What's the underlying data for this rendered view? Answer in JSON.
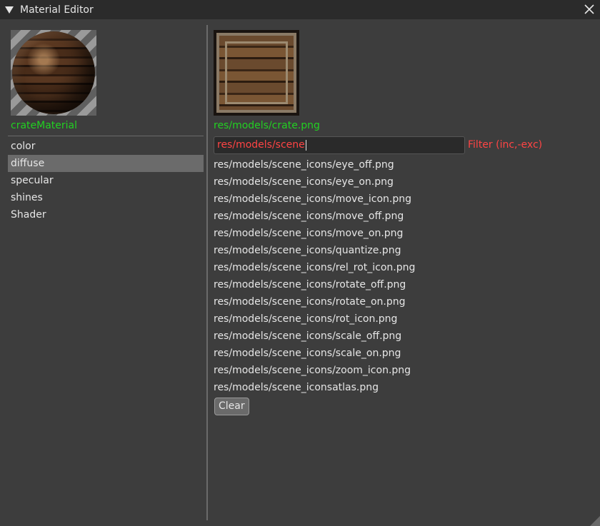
{
  "window": {
    "title": "Material Editor"
  },
  "material": {
    "name": "crateMaterial",
    "properties": [
      "color",
      "diffuse",
      "specular",
      "shines",
      "Shader"
    ],
    "selected_property": "diffuse"
  },
  "texture": {
    "path": "res/models/crate.png",
    "filter_value": "res/models/scene",
    "filter_label": "Filter (inc,-exc)",
    "files": [
      "res/models/scene_icons/eye_off.png",
      "res/models/scene_icons/eye_on.png",
      "res/models/scene_icons/move_icon.png",
      "res/models/scene_icons/move_off.png",
      "res/models/scene_icons/move_on.png",
      "res/models/scene_icons/quantize.png",
      "res/models/scene_icons/rel_rot_icon.png",
      "res/models/scene_icons/rotate_off.png",
      "res/models/scene_icons/rotate_on.png",
      "res/models/scene_icons/rot_icon.png",
      "res/models/scene_icons/scale_off.png",
      "res/models/scene_icons/scale_on.png",
      "res/models/scene_icons/zoom_icon.png",
      "res/models/scene_iconsatlas.png"
    ],
    "clear_label": "Clear"
  },
  "colors": {
    "accent_green": "#22d022",
    "filter_red": "#ff4444",
    "selected_bg": "#6b6b6b"
  }
}
